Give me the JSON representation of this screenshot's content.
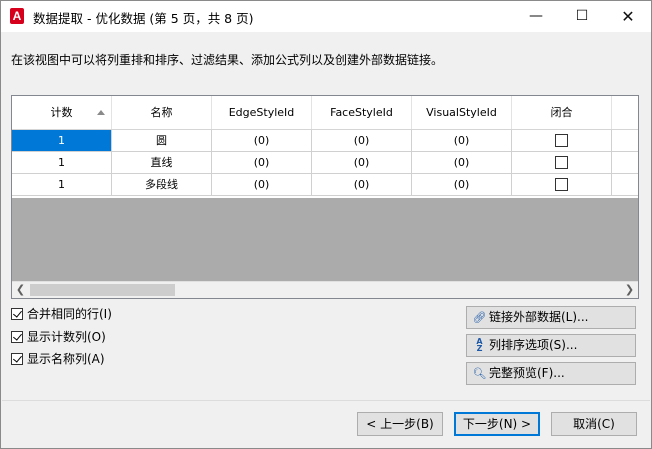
{
  "window": {
    "title": "数据提取 - 优化数据 (第 5 页，共 8 页)",
    "app_icon": "A",
    "controls": {
      "minimize": "—",
      "maximize": "☐",
      "close": "✕"
    }
  },
  "description": "在该视图中可以将列重排和排序、过滤结果、添加公式列以及创建外部数据链接。",
  "grid": {
    "columns": [
      "计数",
      "名称",
      "EdgeStyleId",
      "FaceStyleId",
      "VisualStyleId",
      "闭合"
    ],
    "rows": [
      {
        "count": "1",
        "name": "圆",
        "edge": "(0)",
        "face": "(0)",
        "visual": "(0)",
        "closed": false
      },
      {
        "count": "1",
        "name": "直线",
        "edge": "(0)",
        "face": "(0)",
        "visual": "(0)",
        "closed": false
      },
      {
        "count": "1",
        "name": "多段线",
        "edge": "(0)",
        "face": "(0)",
        "visual": "(0)",
        "closed": false
      }
    ],
    "selected_row": 0,
    "sort_column": "计数",
    "sort_direction": "ascending"
  },
  "options": [
    {
      "label": "合并相同的行(I)",
      "checked": true
    },
    {
      "label": "显示计数列(O)",
      "checked": true
    },
    {
      "label": "显示名称列(A)",
      "checked": true
    }
  ],
  "side_buttons": [
    {
      "label": "链接外部数据(L)...",
      "icon": "link-icon"
    },
    {
      "label": "列排序选项(S)...",
      "icon": "sort-az-icon"
    },
    {
      "label": "完整预览(F)...",
      "icon": "preview-magnifier-icon"
    }
  ],
  "footer": {
    "back": "< 上一步(B)",
    "next": "下一步(N) >",
    "cancel": "取消(C)"
  },
  "colors": {
    "selection": "#0078d7",
    "app_icon": "#d6001c",
    "empty_area": "#ababab"
  }
}
